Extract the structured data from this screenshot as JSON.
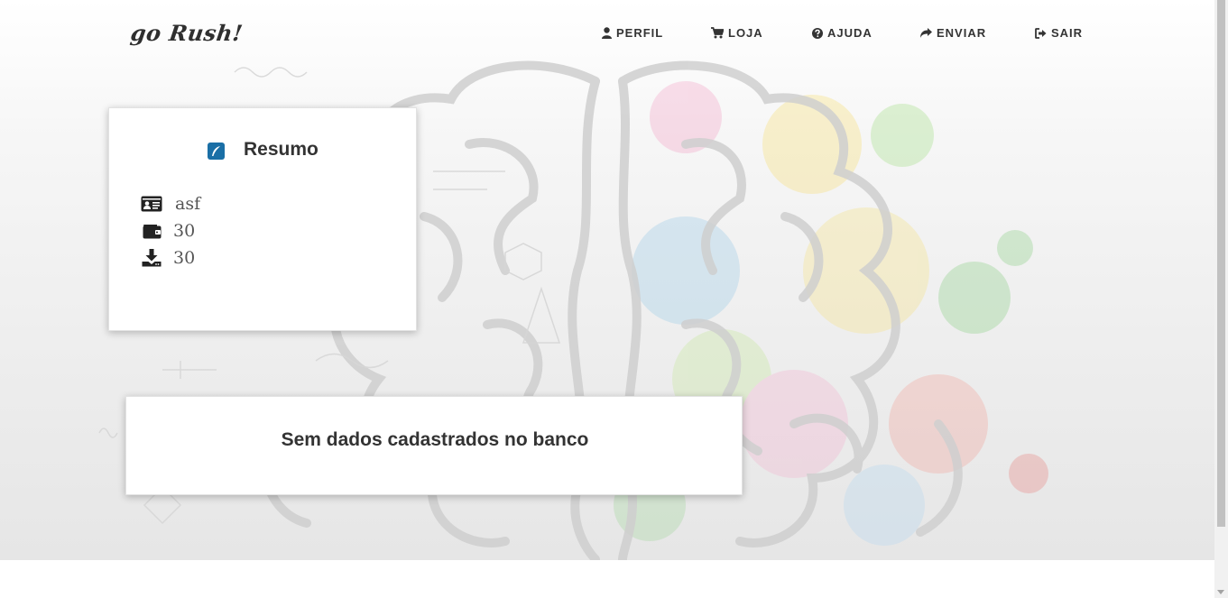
{
  "brand": {
    "logo_text": "go Rush!"
  },
  "nav": {
    "items": [
      {
        "label": "PERFIL",
        "icon": "user-icon"
      },
      {
        "label": "LOJA",
        "icon": "shopping-cart-icon"
      },
      {
        "label": "AJUDA",
        "icon": "question-circle-icon"
      },
      {
        "label": "ENVIAR",
        "icon": "share-icon"
      },
      {
        "label": "SAIR",
        "icon": "sign-out-icon"
      }
    ]
  },
  "summary": {
    "title": "Resumo",
    "title_icon": "feather-square-icon",
    "rows": [
      {
        "icon": "id-card-icon",
        "value": "asf"
      },
      {
        "icon": "wallet-icon",
        "value": "30"
      },
      {
        "icon": "download-icon",
        "value": "30"
      }
    ]
  },
  "empty_state": {
    "message": "Sem dados cadastrados no banco"
  },
  "colors": {
    "accent": "#1a6fa6",
    "text": "#333333",
    "value_text": "#555555"
  }
}
